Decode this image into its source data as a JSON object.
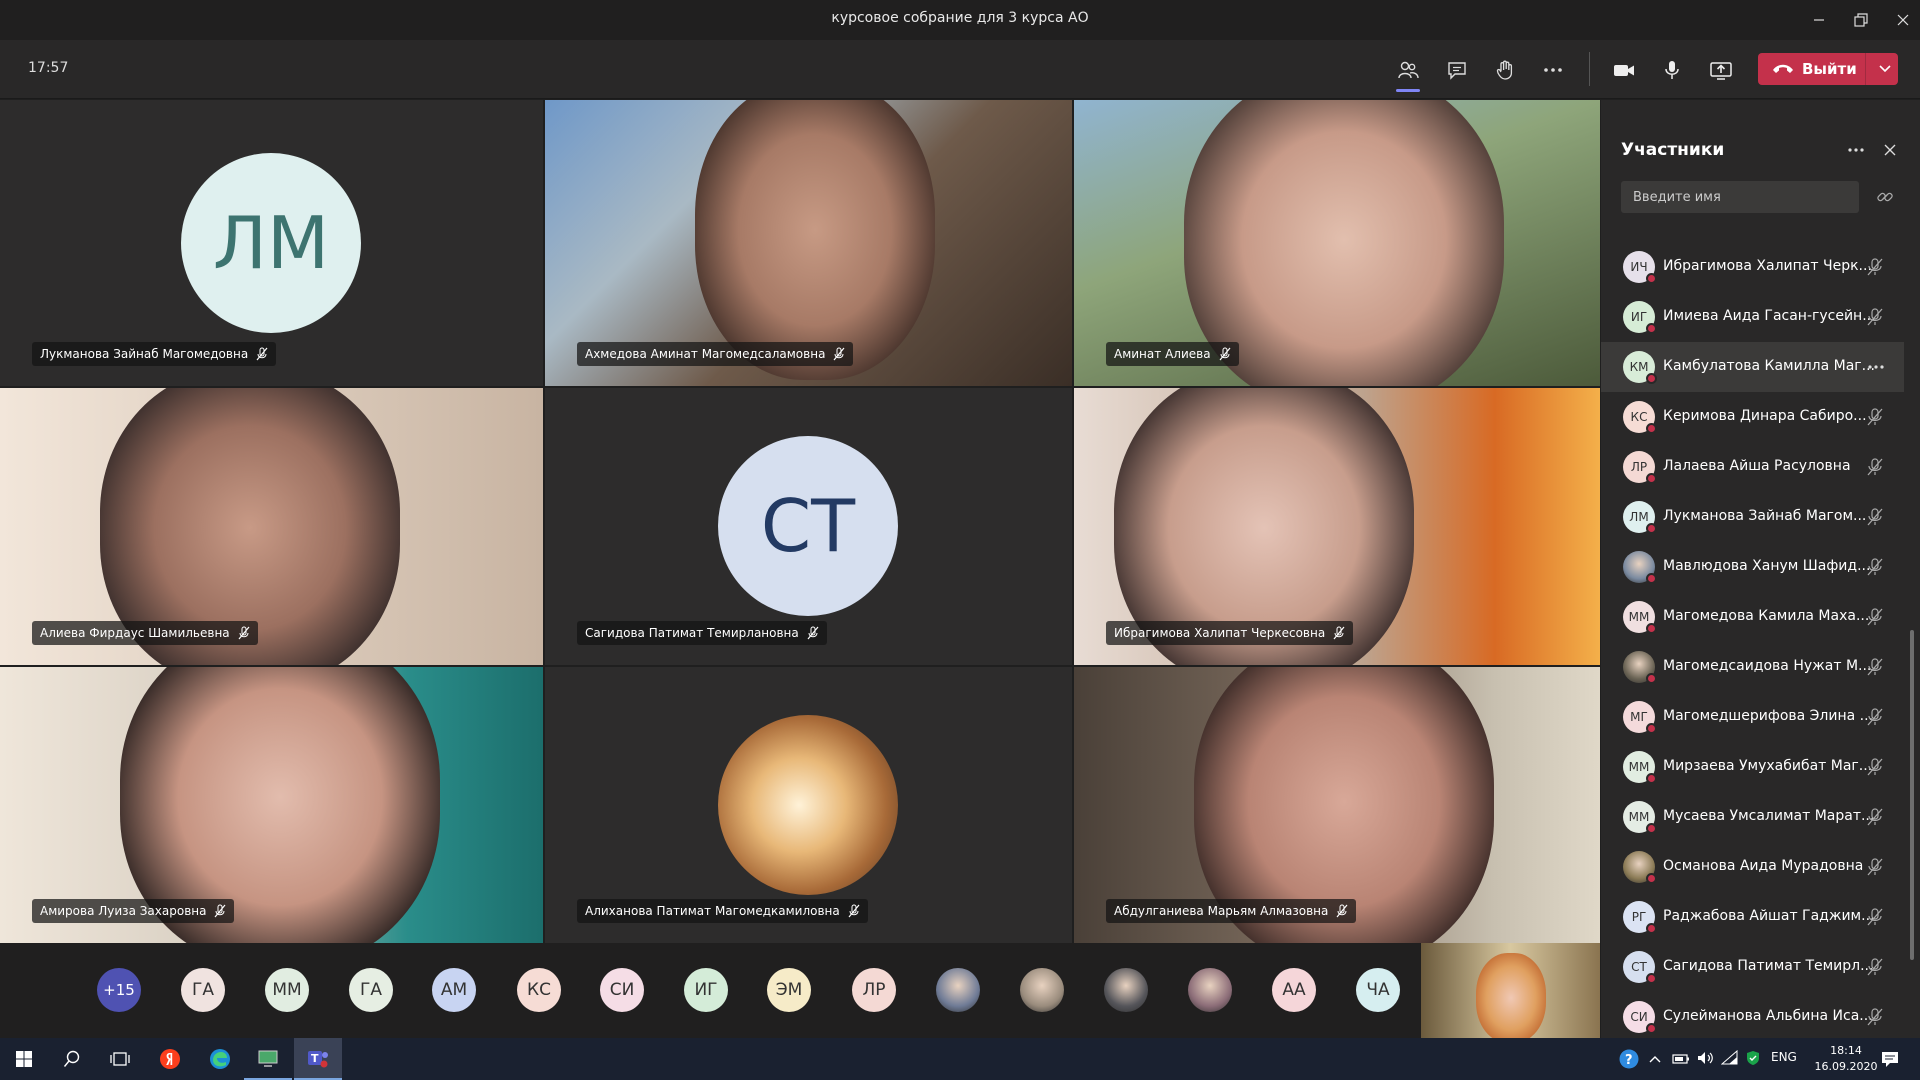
{
  "window": {
    "title": "курсовое собрание для 3 курса АО"
  },
  "toolbar": {
    "time": "17:57",
    "leave_label": "Выйти"
  },
  "tiles": [
    {
      "name": "Лукманова Зайнаб Магомедовна",
      "initials": "ЛМ",
      "color": "#dff0ef",
      "textColor": "#3d7470"
    },
    {
      "name": "Ахмедова Аминат Магомедсаламовна"
    },
    {
      "name": "Аминат Алиева"
    },
    {
      "name": "Алиева Фирдаус Шамильевна"
    },
    {
      "name": "Сагидова Патимат Темирлановна",
      "initials": "СТ",
      "color": "#d6dfef",
      "textColor": "#233a63"
    },
    {
      "name": "Ибрагимова Халипат Черкесовна"
    },
    {
      "name": "Амирова Луиза Захаровна"
    },
    {
      "name": "Алиханова Патимат Магомедкамиловна"
    },
    {
      "name": "Абдулганиева Марьям Алмазовна"
    }
  ],
  "bottom_bar": {
    "overflow": "+15",
    "avatars": [
      {
        "initials": "ГА",
        "color": "#f0e3e0"
      },
      {
        "initials": "ММ",
        "color": "#e1ede1"
      },
      {
        "initials": "ГА",
        "color": "#e6eee3"
      },
      {
        "initials": "АМ",
        "color": "#c8d4f2"
      },
      {
        "initials": "КС",
        "color": "#f6dcd5"
      },
      {
        "initials": "СИ",
        "color": "#f5dde6"
      },
      {
        "initials": "ИГ",
        "color": "#d4ecd8"
      },
      {
        "initials": "ЭМ",
        "color": "#f6ebc8"
      },
      {
        "initials": "ЛР",
        "color": "#f4d9d4"
      },
      {
        "initials": "",
        "color": "#6f7b96"
      },
      {
        "initials": "",
        "color": "#9a8c7d"
      },
      {
        "initials": "",
        "color": "#55555a"
      },
      {
        "initials": "",
        "color": "#8c6d78"
      },
      {
        "initials": "АА",
        "color": "#f5d6d9"
      },
      {
        "initials": "ЧА",
        "color": "#d6eef0"
      }
    ]
  },
  "sidebar": {
    "title": "Участники",
    "search_placeholder": "Введите имя",
    "participants": [
      {
        "initials": "ИЧ",
        "name": "Ибрагимова Халипат Черк...",
        "color": "#e6e0ea"
      },
      {
        "initials": "ИГ",
        "name": "Имиева Аида Гасан-гусейн...",
        "color": "#d6ecd6"
      },
      {
        "initials": "КМ",
        "name": "Камбулатова Камилла Маг...",
        "color": "#d8ecd8",
        "highlight": true
      },
      {
        "initials": "КС",
        "name": "Керимова Динара Сабиро...",
        "color": "#f6dcd5"
      },
      {
        "initials": "ЛР",
        "name": "Лалаева Айша Расуловна",
        "color": "#f4d9d4"
      },
      {
        "initials": "ЛМ",
        "name": "Лукманова Зайнаб Магом...",
        "color": "#dff0ef"
      },
      {
        "initials": "",
        "name": "Мавлюдова Ханум Шафид...",
        "color": "#7a8aa0"
      },
      {
        "initials": "ММ",
        "name": "Магомедова Камила Маха...",
        "color": "#f0dfe0"
      },
      {
        "initials": "",
        "name": "Магомедсаидова Нужат М...",
        "color": "#6b6455"
      },
      {
        "initials": "МГ",
        "name": "Магомедшерифова Элина ...",
        "color": "#f4dadb"
      },
      {
        "initials": "ММ",
        "name": "Мирзаева Умухабибат Маг...",
        "color": "#e1ede1"
      },
      {
        "initials": "ММ",
        "name": "Мусаева Умсалимат Марат...",
        "color": "#e4ece4"
      },
      {
        "initials": "",
        "name": "Османова Аида Мурадовна",
        "color": "#8a7a55"
      },
      {
        "initials": "РГ",
        "name": "Раджабова Айшат Гаджим...",
        "color": "#dbe3f3"
      },
      {
        "initials": "СТ",
        "name": "Сагидова Патимат Темирл...",
        "color": "#d6dfef"
      },
      {
        "initials": "СИ",
        "name": "Сулейманова Альбина Иса...",
        "color": "#f5dde6"
      }
    ]
  },
  "taskbar": {
    "lang": "ENG",
    "clock_time": "18:14",
    "clock_date": "16.09.2020"
  }
}
